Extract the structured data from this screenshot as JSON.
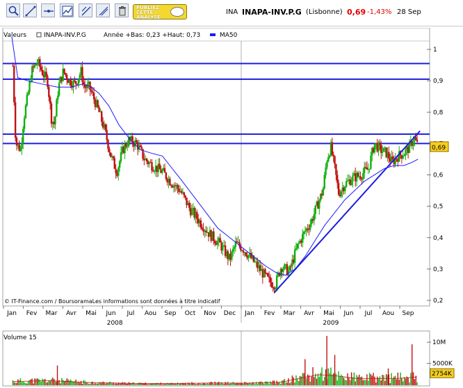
{
  "toolbar": {
    "tools": [
      "zoom-icon",
      "draw-line-icon",
      "horizontal-line-icon",
      "indicator-icon",
      "trend-icon",
      "parallel-icon",
      "trash-icon"
    ],
    "promo": {
      "line1": "PUBLIEZ",
      "line2": "CETTE",
      "line3": "ANALYSE"
    }
  },
  "header": {
    "code": "INA",
    "name": "INAPA-INV.P.G",
    "market": "(Lisbonne)",
    "price": "0,69",
    "change": "-1,43%",
    "date": "28 Sep",
    "change_color": "#e00000"
  },
  "legend": {
    "label_valeurs": "Valeurs",
    "series_name": "INAPA-INV.P.G",
    "range_text": "Année +Bas: 0,23 +Haut: 0,73",
    "ma_label": "MA50",
    "ma_color": "#1a1aff"
  },
  "footer_note": "© IT-Finance.com / BoursoramaLes informations sont données à titre indicatif",
  "chart_data": {
    "type": "candlestick",
    "price_axis": {
      "ticks": [
        "1",
        "0,9",
        "0,8",
        "0,7",
        "0,6",
        "0,5",
        "0,4",
        "0,3",
        "0,2"
      ],
      "ylim": [
        0.2,
        1.04
      ],
      "last_label": "0,69"
    },
    "x_axis": {
      "months": [
        "Jan",
        "Fev",
        "Mar",
        "Avr",
        "Mai",
        "Jun",
        "Jul",
        "Aou",
        "Sep",
        "Oct",
        "Nov",
        "Dec",
        "Jan",
        "Fev",
        "Mar",
        "Avr",
        "Mai",
        "Jun",
        "Jul",
        "Aou",
        "Sep"
      ],
      "years": [
        "2008",
        "2009"
      ]
    },
    "horizontal_lines": [
      0.955,
      0.905,
      0.73,
      0.7
    ],
    "trendline": {
      "start": [
        13.25,
        0.225
      ],
      "end": [
        20.6,
        0.74
      ]
    },
    "price_path": [
      [
        0.0,
        1.03
      ],
      [
        0.2,
        0.7
      ],
      [
        0.45,
        0.68
      ],
      [
        0.6,
        0.78
      ],
      [
        0.8,
        0.85
      ],
      [
        1.0,
        0.93
      ],
      [
        1.3,
        0.96
      ],
      [
        1.6,
        0.92
      ],
      [
        1.8,
        0.9
      ],
      [
        2.0,
        0.78
      ],
      [
        2.15,
        0.76
      ],
      [
        2.35,
        0.88
      ],
      [
        2.6,
        0.93
      ],
      [
        2.9,
        0.9
      ],
      [
        3.2,
        0.89
      ],
      [
        3.5,
        0.93
      ],
      [
        3.65,
        0.88
      ],
      [
        3.9,
        0.88
      ],
      [
        4.1,
        0.85
      ],
      [
        4.4,
        0.8
      ],
      [
        4.7,
        0.74
      ],
      [
        5.0,
        0.66
      ],
      [
        5.3,
        0.61
      ],
      [
        5.6,
        0.68
      ],
      [
        5.9,
        0.71
      ],
      [
        6.3,
        0.7
      ],
      [
        6.7,
        0.65
      ],
      [
        7.1,
        0.63
      ],
      [
        7.6,
        0.61
      ],
      [
        8.0,
        0.58
      ],
      [
        8.5,
        0.55
      ],
      [
        9.0,
        0.49
      ],
      [
        9.5,
        0.45
      ],
      [
        10.0,
        0.41
      ],
      [
        10.5,
        0.38
      ],
      [
        11.0,
        0.33
      ],
      [
        11.3,
        0.38
      ],
      [
        11.6,
        0.37
      ],
      [
        12.0,
        0.34
      ],
      [
        12.5,
        0.3
      ],
      [
        13.0,
        0.26
      ],
      [
        13.3,
        0.25
      ],
      [
        13.6,
        0.31
      ],
      [
        14.0,
        0.29
      ],
      [
        14.4,
        0.37
      ],
      [
        14.8,
        0.42
      ],
      [
        15.1,
        0.45
      ],
      [
        15.4,
        0.5
      ],
      [
        15.7,
        0.55
      ],
      [
        15.9,
        0.65
      ],
      [
        16.1,
        0.69
      ],
      [
        16.3,
        0.62
      ],
      [
        16.5,
        0.54
      ],
      [
        16.8,
        0.57
      ],
      [
        17.2,
        0.59
      ],
      [
        17.6,
        0.6
      ],
      [
        18.0,
        0.62
      ],
      [
        18.3,
        0.7
      ],
      [
        18.6,
        0.68
      ],
      [
        18.9,
        0.67
      ],
      [
        19.2,
        0.64
      ],
      [
        19.5,
        0.66
      ],
      [
        19.8,
        0.67
      ],
      [
        20.1,
        0.69
      ],
      [
        20.3,
        0.72
      ],
      [
        20.5,
        0.69
      ]
    ],
    "ma50_path": [
      [
        0.0,
        1.04
      ],
      [
        0.3,
        0.91
      ],
      [
        0.8,
        0.9
      ],
      [
        1.5,
        0.89
      ],
      [
        2.3,
        0.88
      ],
      [
        3.0,
        0.88
      ],
      [
        3.6,
        0.89
      ],
      [
        4.0,
        0.88
      ],
      [
        4.4,
        0.86
      ],
      [
        4.9,
        0.82
      ],
      [
        5.4,
        0.76
      ],
      [
        6.0,
        0.71
      ],
      [
        6.5,
        0.68
      ],
      [
        7.0,
        0.67
      ],
      [
        7.6,
        0.66
      ],
      [
        8.1,
        0.62
      ],
      [
        8.6,
        0.58
      ],
      [
        9.2,
        0.53
      ],
      [
        9.8,
        0.48
      ],
      [
        10.4,
        0.43
      ],
      [
        11.0,
        0.4
      ],
      [
        11.6,
        0.37
      ],
      [
        12.2,
        0.34
      ],
      [
        12.8,
        0.31
      ],
      [
        13.3,
        0.29
      ],
      [
        13.8,
        0.28
      ],
      [
        14.3,
        0.3
      ],
      [
        14.8,
        0.34
      ],
      [
        15.3,
        0.39
      ],
      [
        15.8,
        0.44
      ],
      [
        16.3,
        0.48
      ],
      [
        16.8,
        0.52
      ],
      [
        17.3,
        0.55
      ],
      [
        17.8,
        0.58
      ],
      [
        18.3,
        0.6
      ],
      [
        18.8,
        0.62
      ],
      [
        19.3,
        0.63
      ],
      [
        19.8,
        0.63
      ],
      [
        20.2,
        0.64
      ],
      [
        20.5,
        0.65
      ]
    ],
    "volume_panel": {
      "title": "Volume 15",
      "axis_labels": [
        "10M",
        "5000K"
      ],
      "last_label": "2754K",
      "ylim": [
        0,
        12000000
      ],
      "volume_profile": [
        [
          0,
          0.8
        ],
        [
          2,
          1.0
        ],
        [
          4,
          0.5
        ],
        [
          6,
          0.3
        ],
        [
          8,
          0.25
        ],
        [
          10,
          0.4
        ],
        [
          12,
          0.35
        ],
        [
          13.6,
          0.6
        ],
        [
          14.5,
          1.6
        ],
        [
          15.5,
          2.6
        ],
        [
          16.5,
          2.2
        ],
        [
          17.5,
          1.5
        ],
        [
          18.5,
          1.6
        ],
        [
          19.5,
          1.6
        ],
        [
          20.5,
          2.0
        ]
      ],
      "spikes": [
        [
          15.9,
          11.5
        ],
        [
          20.2,
          9.5
        ],
        [
          14.8,
          6.0
        ],
        [
          16.3,
          7.0
        ],
        [
          2.3,
          4.5
        ],
        [
          19.0,
          3.8
        ]
      ]
    }
  }
}
